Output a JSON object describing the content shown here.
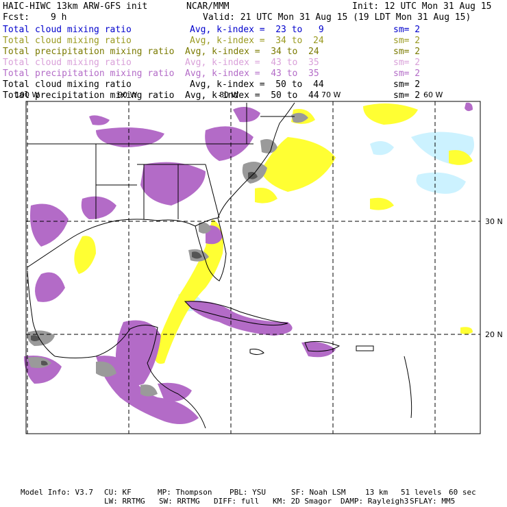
{
  "header": {
    "model": "HAIC-HIWC 13km ARW-GFS init",
    "org": "NCAR/MMM",
    "init": "Init: 12 UTC Mon 31 Aug 15",
    "fcst_label": "Fcst:",
    "fcst_value": "9 h",
    "valid": "Valid: 21 UTC Mon 31 Aug 15 (19 LDT Mon 31 Aug 15)"
  },
  "legend": [
    {
      "name": "Total cloud mixing ratio",
      "stat": "Avg, k-index =  23 to   9",
      "sm": "sm= 2",
      "color": "#0000cc"
    },
    {
      "name": "Total cloud mixing ratio",
      "stat": "Avg, k-index =  34 to  24",
      "sm": "sm= 2",
      "color": "#99991f"
    },
    {
      "name": "Total precipitation mixing ratio",
      "stat": "Avg, k-index =  34 to  24",
      "sm": "sm= 2",
      "color": "#7a7a00"
    },
    {
      "name": "Total cloud mixing ratio",
      "stat": "Avg, k-index =  43 to  35",
      "sm": "sm= 2",
      "color": "#d9a0d9"
    },
    {
      "name": "Total precipitation mixing ratio",
      "stat": "Avg, k-index =  43 to  35",
      "sm": "sm= 2",
      "color": "#b36bc7"
    },
    {
      "name": "Total cloud mixing ratio",
      "stat": "Avg, k-index =  50 to  44",
      "sm": "sm= 2",
      "color": "#000000"
    },
    {
      "name": "Total precipitation mixing ratio",
      "stat": "Avg, k-index =  50 to  44",
      "sm": "sm= 2",
      "color": "#000000"
    }
  ],
  "map": {
    "lon_labels": [
      "100 W",
      "90 W",
      "80 W",
      "70 W",
      "60 W"
    ],
    "lat_labels": [
      "30 N",
      "20 N"
    ],
    "colors": {
      "cyan": "#ccf2ff",
      "yellow": "#ffff33",
      "purple": "#b36bc7",
      "gray": "#9a9a9a",
      "darkgray": "#555555",
      "border": "#000000",
      "grid": "#000000"
    }
  },
  "footer": {
    "line1": [
      "Model Info: V3.7",
      "CU: KF",
      "MP: Thompson",
      "PBL: YSU",
      "SF: Noah LSM",
      "13 km",
      "51 levels",
      "60 sec"
    ],
    "line2": [
      "LW: RRTMG",
      "SW: RRTMG",
      "DIFF: full",
      "KM: 2D Smagor",
      "DAMP: Rayleigh3",
      "SFLAY: MM5"
    ]
  }
}
